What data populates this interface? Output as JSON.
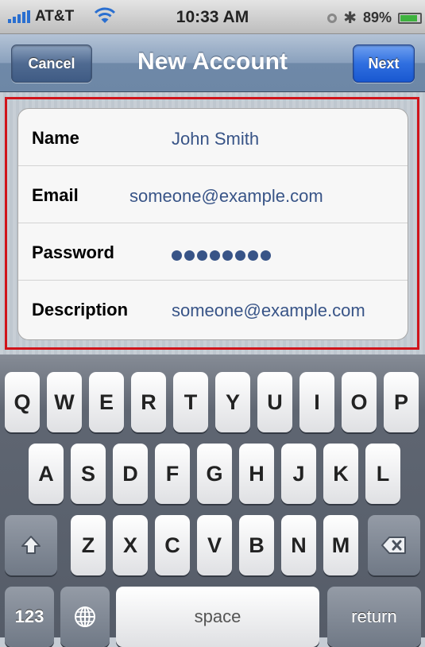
{
  "status_bar": {
    "carrier": "AT&T",
    "time": "10:33 AM",
    "battery_percent": "89%",
    "battery_level": 0.89,
    "icons": [
      "signal-bars-icon",
      "wifi-icon",
      "orientation-lock-icon",
      "bluetooth-icon",
      "battery-icon"
    ]
  },
  "nav": {
    "title": "New Account",
    "cancel_label": "Cancel",
    "next_label": "Next"
  },
  "form": {
    "rows": [
      {
        "label": "Name",
        "value": "John Smith"
      },
      {
        "label": "Email",
        "value": "someone@example.com"
      },
      {
        "label": "Password",
        "value": "",
        "masked_length": 8
      },
      {
        "label": "Description",
        "value": "someone@example.com"
      }
    ],
    "highlight_color": "#d0141b"
  },
  "keyboard": {
    "row1": [
      "Q",
      "W",
      "E",
      "R",
      "T",
      "Y",
      "U",
      "I",
      "O",
      "P"
    ],
    "row2": [
      "A",
      "S",
      "D",
      "F",
      "G",
      "H",
      "J",
      "K",
      "L"
    ],
    "row3": [
      "Z",
      "X",
      "C",
      "V",
      "B",
      "N",
      "M"
    ],
    "numbers_label": "123",
    "space_label": "space",
    "return_label": "return",
    "icons": [
      "shift-icon",
      "backspace-icon",
      "globe-icon"
    ]
  }
}
